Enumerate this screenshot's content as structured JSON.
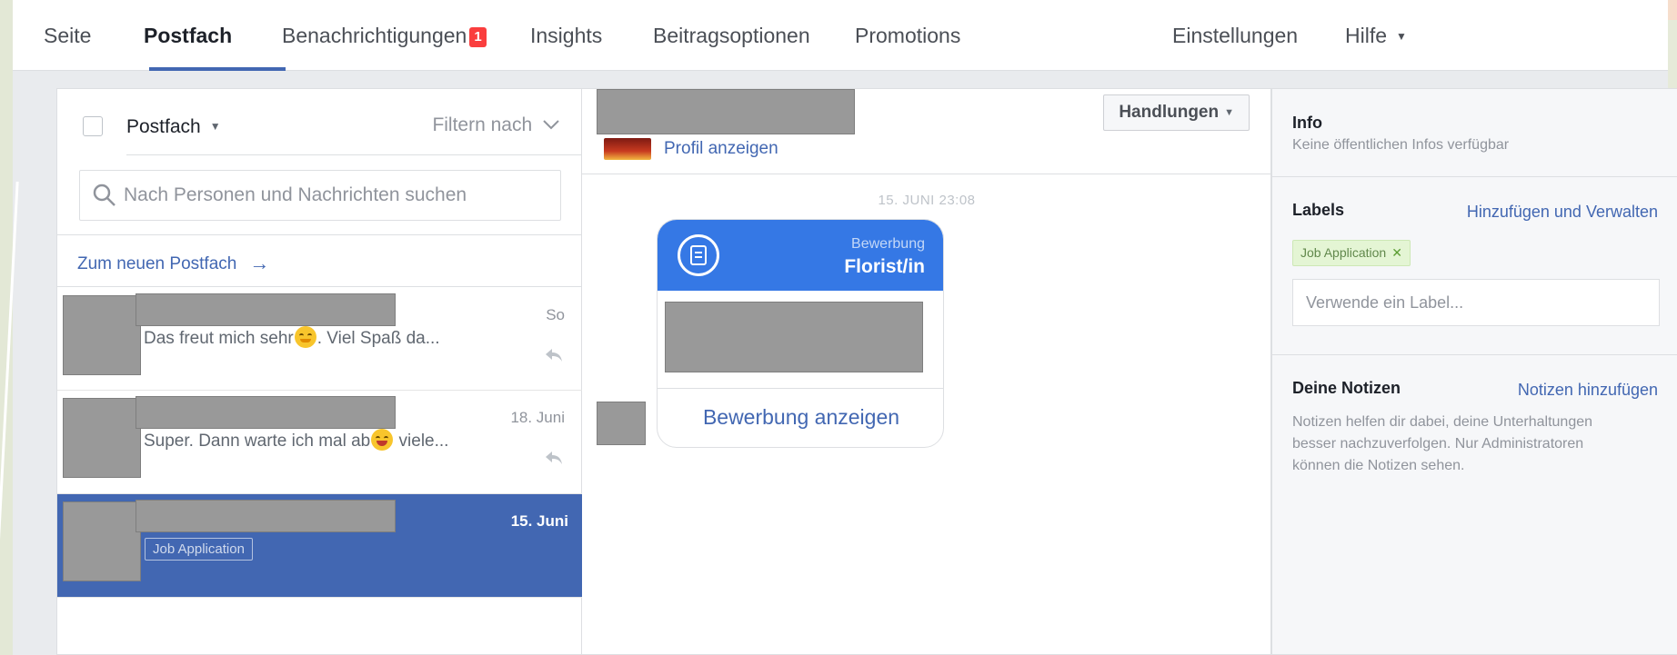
{
  "nav": {
    "items": [
      {
        "label": "Seite"
      },
      {
        "label": "Postfach"
      },
      {
        "label": "Benachrichtigungen",
        "badge": "1"
      },
      {
        "label": "Insights"
      },
      {
        "label": "Beitragsoptionen"
      },
      {
        "label": "Promotions"
      },
      {
        "label": "Einstellungen"
      },
      {
        "label": "Hilfe"
      }
    ],
    "active": "Postfach"
  },
  "inbox": {
    "dropdown_label": "Postfach",
    "filter_label": "Filtern nach",
    "search_placeholder": "Nach Personen und Nachrichten suchen",
    "new_inbox_link": "Zum neuen Postfach",
    "conversations": [
      {
        "preview_before": "Das freut mich sehr",
        "emoji": "smiling-face",
        "preview_after": ". Viel Spaß da...",
        "time": "So"
      },
      {
        "preview_before": "Super. Dann warte ich mal ab",
        "emoji": "grinning-sweat-face",
        "preview_after": " viele...",
        "time": "18. Juni"
      },
      {
        "label_tag": "Job Application",
        "time": "15. Juni",
        "selected": true
      }
    ]
  },
  "conversation": {
    "profile_link": "Profil anzeigen",
    "actions_label": "Handlungen",
    "timestamp": "15. JUNI 23:08",
    "card": {
      "kicker": "Bewerbung",
      "title": "Florist/in",
      "link": "Bewerbung anzeigen",
      "icon": "document-icon"
    }
  },
  "info": {
    "title": "Info",
    "text": "Keine öffentlichen Infos verfügbar"
  },
  "labels": {
    "title": "Labels",
    "manage_link": "Hinzufügen und Verwalten",
    "chip": "Job Application",
    "input_placeholder": "Verwende ein Label..."
  },
  "notes": {
    "title": "Deine Notizen",
    "add_link": "Notizen hinzufügen",
    "text": "Notizen helfen dir dabei, deine Unterhaltungen besser nachzuverfolgen. Nur Administratoren können die Notizen sehen."
  },
  "colors": {
    "brand": "#4267b2",
    "card_header": "#3578e5",
    "badge": "#fa3e3e",
    "chip_bg": "#e4f5d4"
  }
}
